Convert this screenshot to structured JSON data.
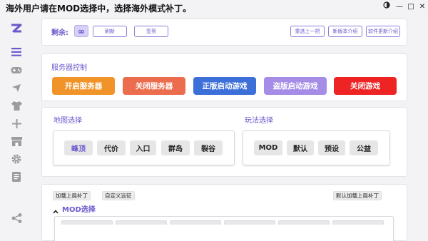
{
  "window": {
    "title": "海外用户请在MOD选择中，选择海外模式补丁。",
    "controls": {
      "theme_icon": "contrast-icon",
      "minimize": "—",
      "maximize": "□",
      "close": "✕"
    }
  },
  "sidebar": {
    "logo_text": "Z",
    "items": [
      {
        "name": "list-icon"
      },
      {
        "name": "gamepad-icon"
      },
      {
        "name": "airplane-icon"
      },
      {
        "name": "shirt-icon"
      },
      {
        "name": "plus-icon"
      },
      {
        "name": "store-icon"
      },
      {
        "name": "gear-icon"
      },
      {
        "name": "document-icon"
      },
      {
        "name": "share-icon"
      }
    ]
  },
  "top_bar": {
    "remaining_label": "剩余:",
    "remaining_value": "∞",
    "refresh_label": "刷新",
    "sign_in_label": "签到",
    "revert_label": "重选上一把",
    "new_version_label": "新版本介绍",
    "software_update_label": "软件更新介绍"
  },
  "server_control": {
    "title": "服务器控制",
    "buttons": [
      {
        "label": "开启服务器",
        "color": "#f0942a"
      },
      {
        "label": "关闭服务器",
        "color": "#ec6c4e"
      },
      {
        "label": "正版启动游戏",
        "color": "#3c6fd8"
      },
      {
        "label": "盗版启动游戏",
        "color": "#a58ce6"
      },
      {
        "label": "关闭游戏",
        "color": "#ee2424"
      }
    ]
  },
  "map_select": {
    "title": "地图选择",
    "options": [
      "峰顶",
      "代价",
      "入口",
      "群岛",
      "裂谷"
    ],
    "selected": "峰顶"
  },
  "mode_select": {
    "title": "玩法选择",
    "options": [
      "MOD",
      "默认",
      "预设",
      "公益"
    ]
  },
  "mods": {
    "load_last_patch": "加载上局补丁",
    "custom_expedition": "自定义远征",
    "default_load_last_patch": "默认加载上局补丁",
    "section_title": "MOD选择",
    "collapse_icon": "chevron-up-icon"
  },
  "colors": {
    "accent": "#6a5acd",
    "background": "#f3f3f5"
  }
}
